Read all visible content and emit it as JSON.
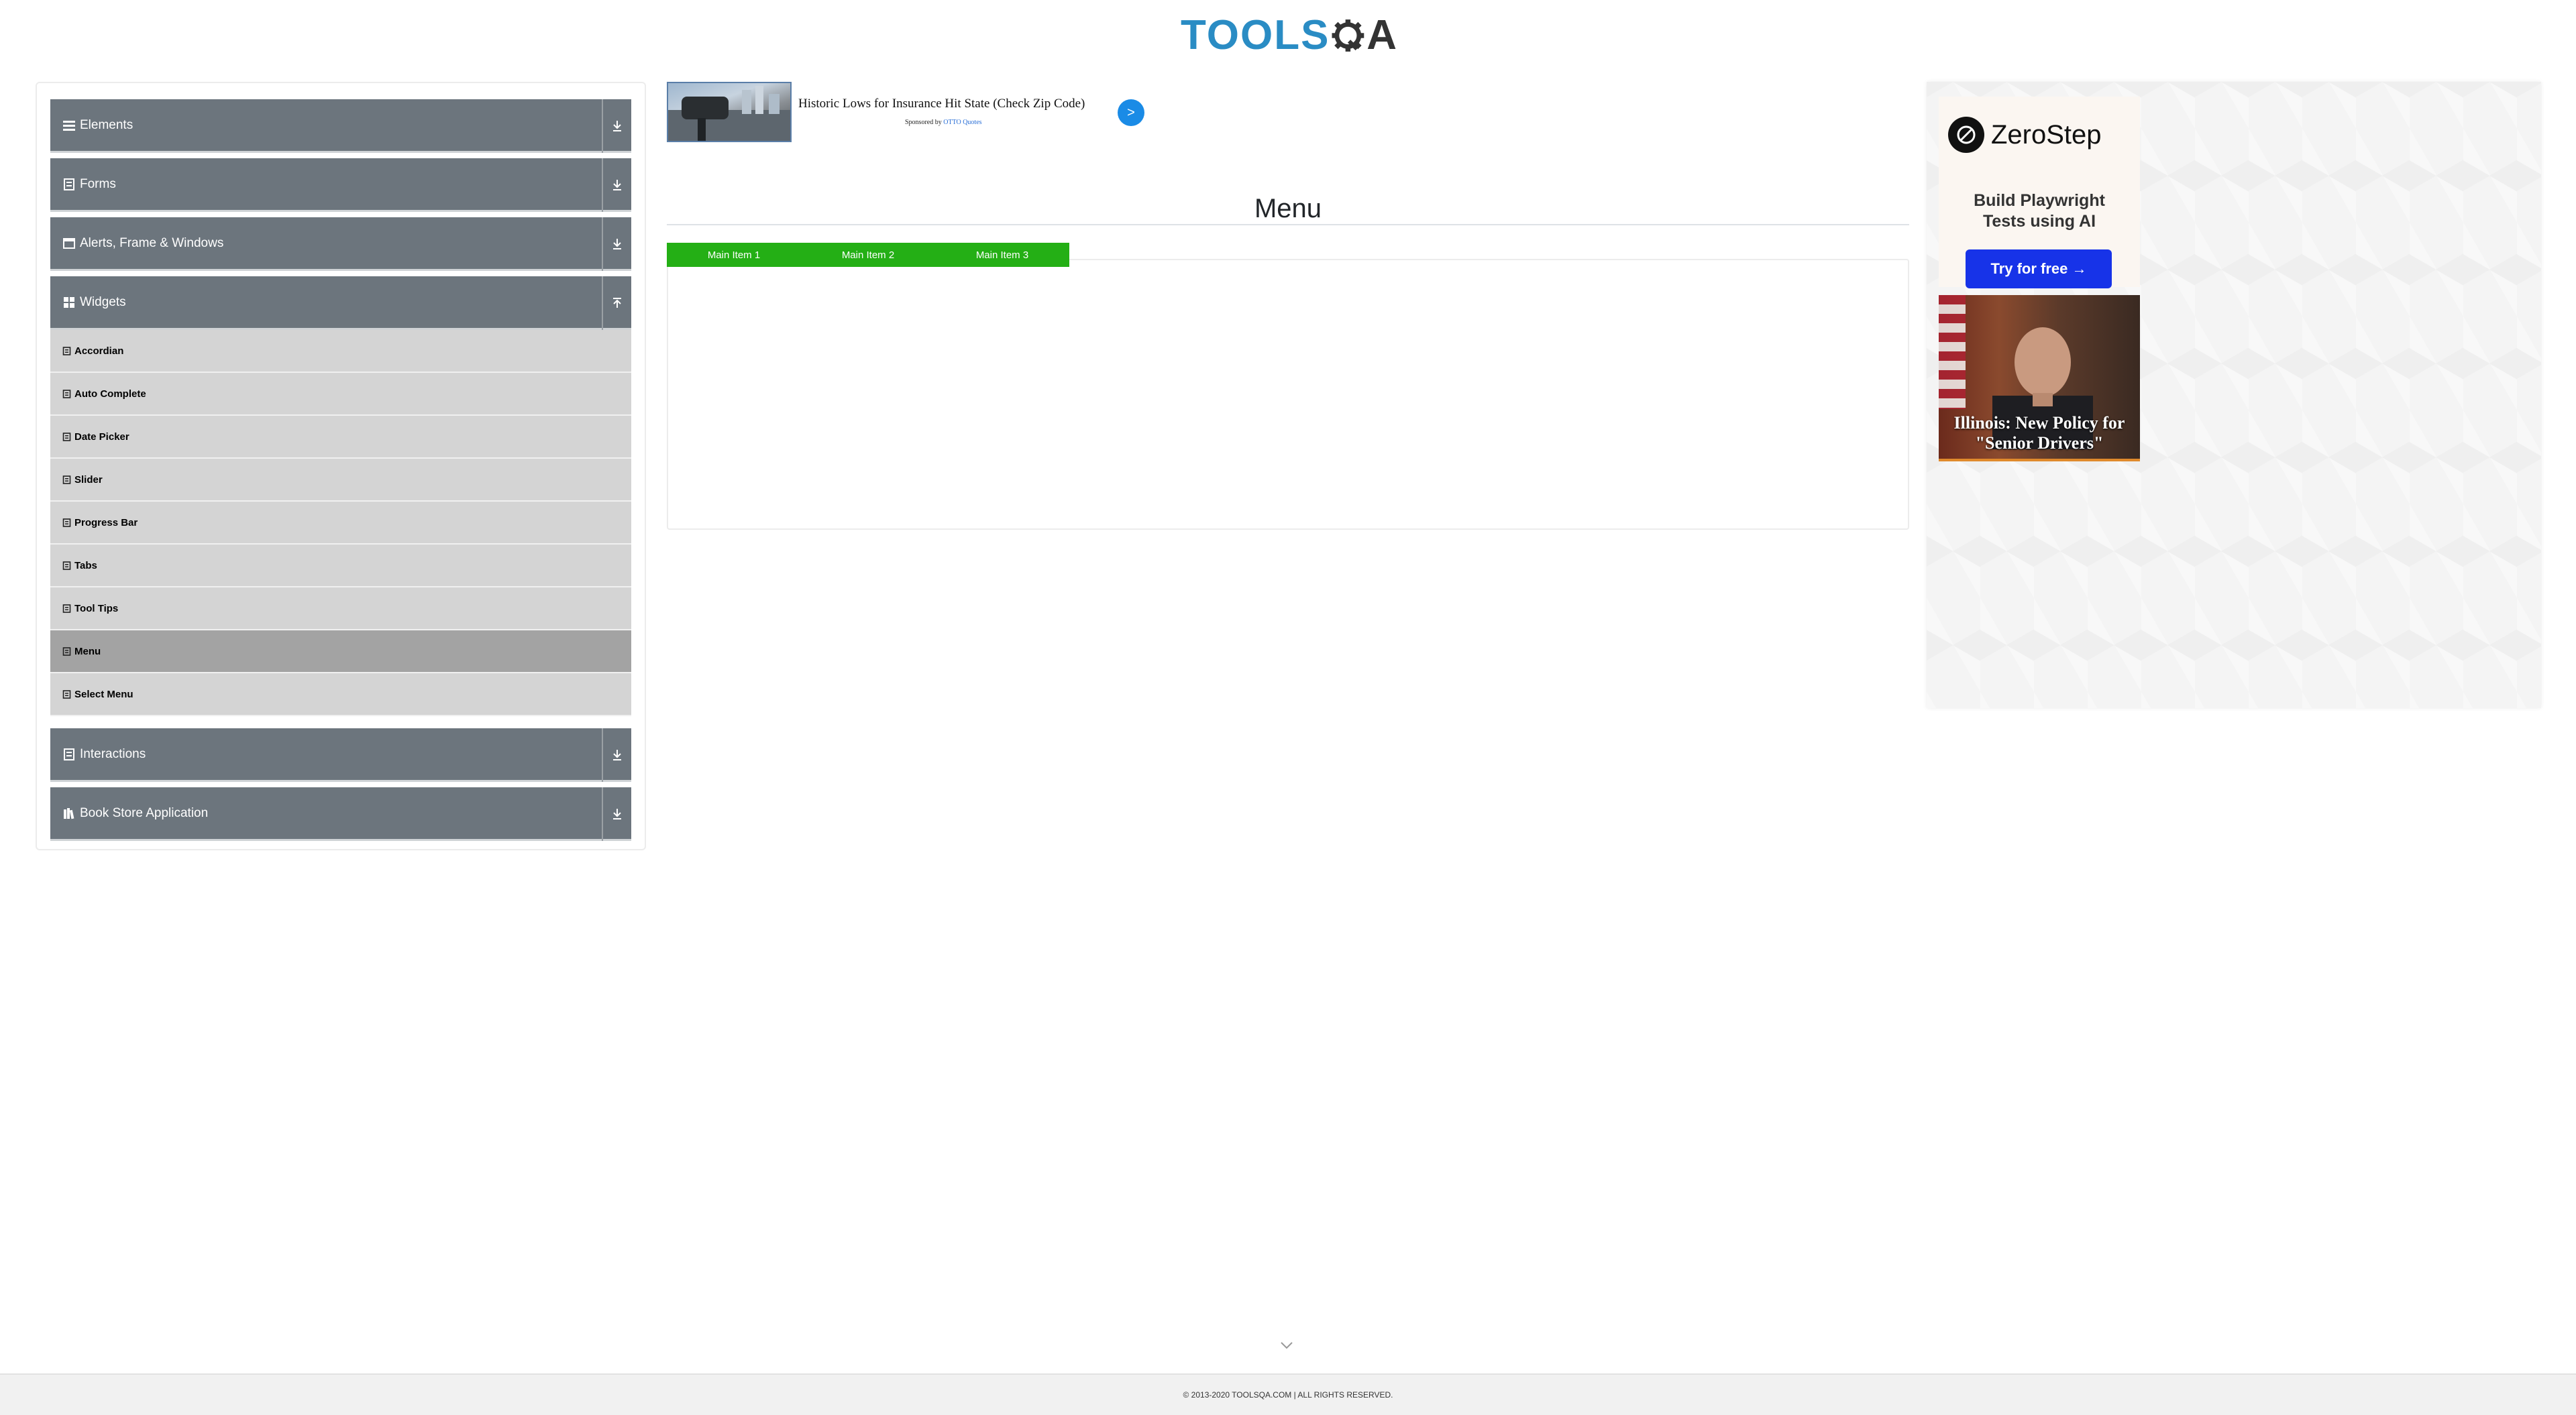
{
  "header": {
    "logo_text": "TOOLS",
    "logo_text_suffix": "A",
    "brand_color": "#2a8cc4"
  },
  "sidebar": {
    "groups": [
      {
        "label": "Elements",
        "icon": "hamburger-icon",
        "expanded": false
      },
      {
        "label": "Forms",
        "icon": "document-icon",
        "expanded": false
      },
      {
        "label": "Alerts, Frame & Windows",
        "icon": "window-icon",
        "expanded": false
      },
      {
        "label": "Widgets",
        "icon": "grid-icon",
        "expanded": true,
        "items": [
          {
            "label": "Accordian"
          },
          {
            "label": "Auto Complete"
          },
          {
            "label": "Date Picker"
          },
          {
            "label": "Slider"
          },
          {
            "label": "Progress Bar"
          },
          {
            "label": "Tabs"
          },
          {
            "label": "Tool Tips"
          },
          {
            "label": "Menu",
            "active": true
          },
          {
            "label": "Select Menu"
          }
        ]
      },
      {
        "label": "Interactions",
        "icon": "document-icon",
        "expanded": false
      },
      {
        "label": "Book Store Application",
        "icon": "books-icon",
        "expanded": false
      }
    ],
    "header_color": "#6c757d",
    "item_color": "#d4d4d4",
    "active_item_color": "#a3a3a3"
  },
  "top_ad": {
    "headline": "Historic Lows for Insurance Hit State (Check Zip Code)",
    "sponsored_prefix": "Sponsored by",
    "sponsor": "OTTO Quotes",
    "go_label": ">"
  },
  "main": {
    "title": "Menu",
    "nav_items": [
      "Main Item 1",
      "Main Item 2",
      "Main Item 3"
    ],
    "nav_color": "#24af15"
  },
  "side_ad": {
    "brand": "ZeroStep",
    "tagline_line1": "Build Playwright",
    "tagline_line2": "Tests using AI",
    "button": "Try for free →",
    "button_color": "#1733e8",
    "news_caption_line1": "Illinois: New Policy for",
    "news_caption_line2": "\"Senior Drivers\""
  },
  "footer": {
    "copyright": "© 2013-2020 TOOLSQA.COM | ALL RIGHTS RESERVED."
  }
}
